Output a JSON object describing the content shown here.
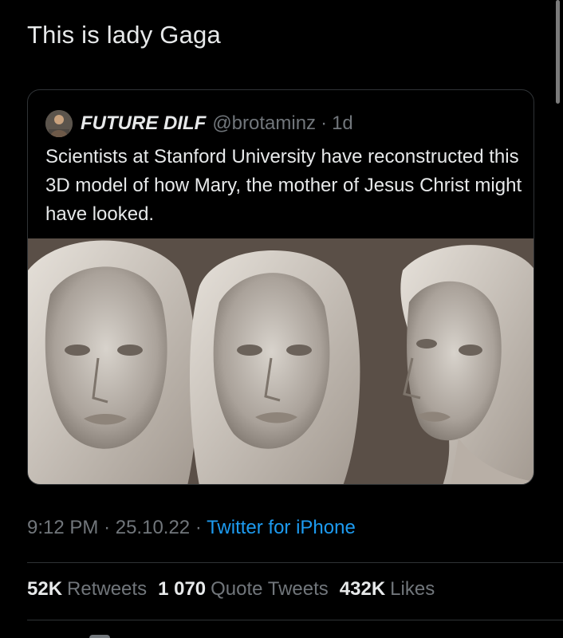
{
  "tweet": {
    "text": "This is lady Gaga"
  },
  "quoted_tweet": {
    "author_name": "FUTURE DILF",
    "author_handle": "@brotaminz",
    "separator": "·",
    "relative_time": "1d",
    "text": "Scientists at Stanford University have reconstructed this 3D model of how Mary, the mother of Jesus Christ might have looked.",
    "media_alt": "Three grayscale 3D sculpted heads of a woman wearing a veil: two frontal views and one three-quarter profile view"
  },
  "meta": {
    "time": "9:12 PM",
    "separator": "·",
    "date": "25.10.22",
    "separator2": "·",
    "source": "Twitter for iPhone"
  },
  "stats": {
    "retweets_count": "52K",
    "retweets_label": "Retweets",
    "quotes_count": "1 070",
    "quotes_label": "Quote Tweets",
    "likes_count": "432K",
    "likes_label": "Likes"
  },
  "colors": {
    "background": "#000000",
    "text_primary": "#e7e9ea",
    "text_secondary": "#71767b",
    "link": "#1d9bf0",
    "border": "#2f3336"
  }
}
